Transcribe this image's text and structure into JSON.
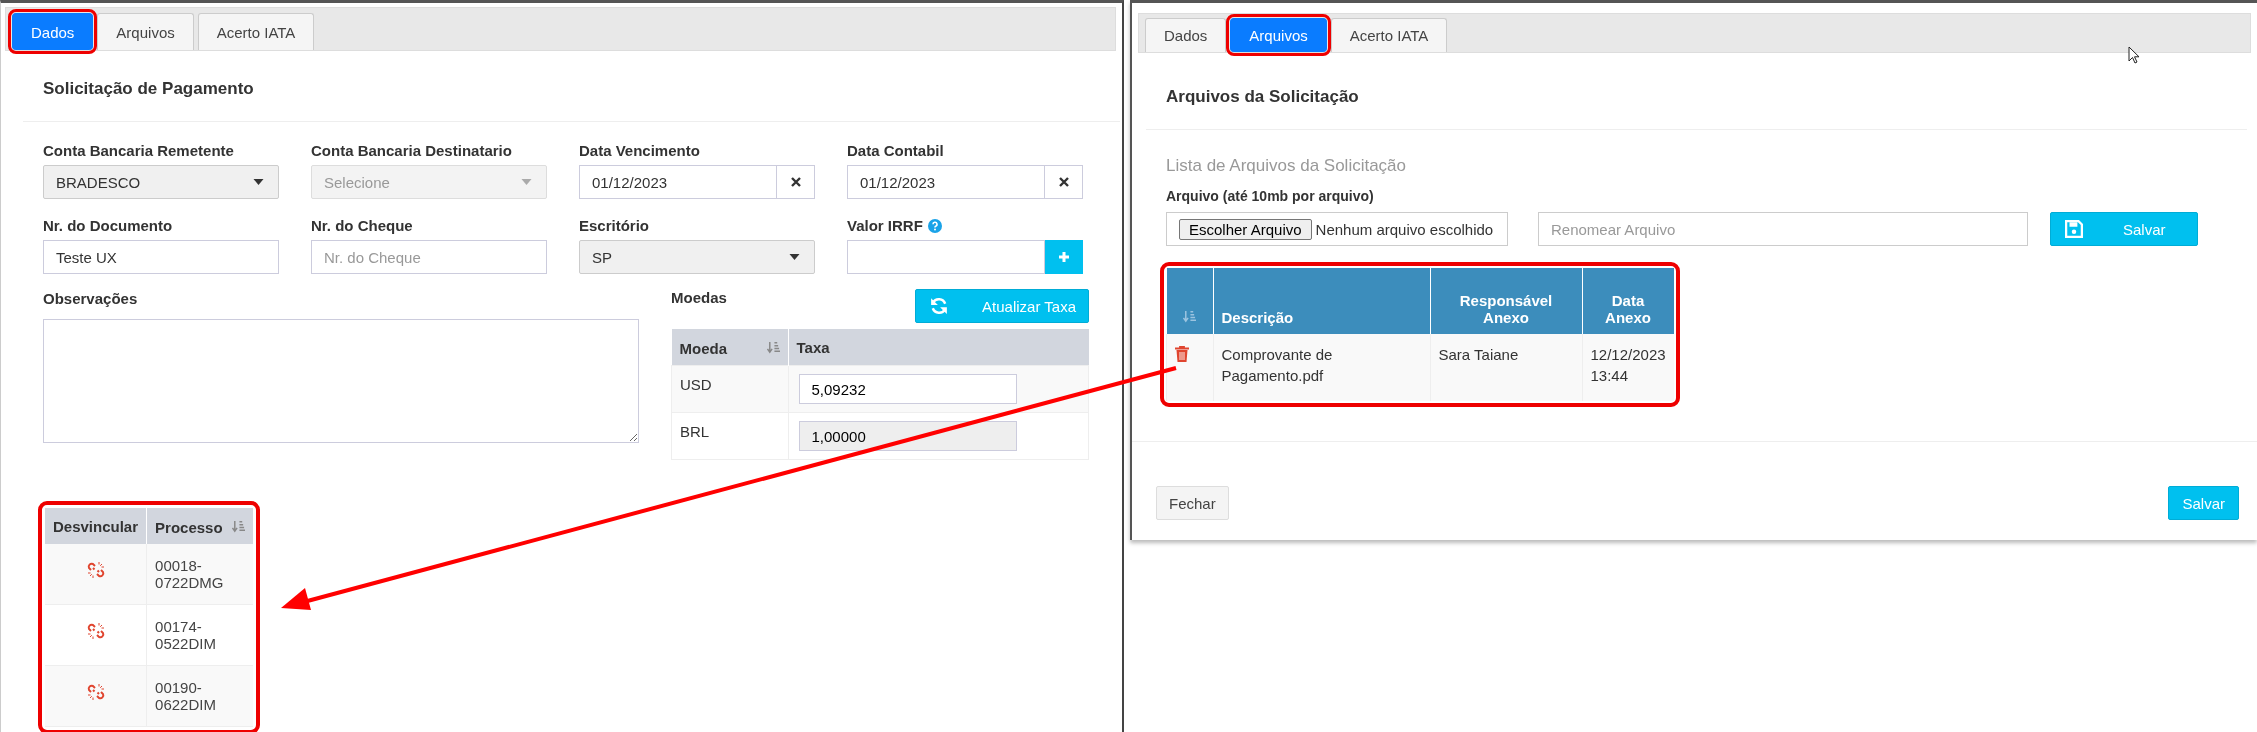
{
  "left_panel": {
    "tabs": [
      {
        "label": "Dados",
        "selected": true,
        "highlighted": true
      },
      {
        "label": "Arquivos",
        "selected": false,
        "highlighted": false
      },
      {
        "label": "Acerto IATA",
        "selected": false,
        "highlighted": false
      }
    ],
    "title": "Solicitação de Pagamento",
    "fields": [
      {
        "label": "Conta Bancaria Remetente",
        "kind": "select",
        "value": "BRADESCO",
        "disabled": false
      },
      {
        "label": "Conta Bancaria Destinatario",
        "kind": "select",
        "placeholder": "Selecione",
        "disabled": true
      },
      {
        "label": "Data Vencimento",
        "kind": "date",
        "value": "01/12/2023"
      },
      {
        "label": "Data Contabil",
        "kind": "date",
        "value": "01/12/2023"
      },
      {
        "label": "Nr. do Documento",
        "kind": "text",
        "value": "Teste UX"
      },
      {
        "label": "Nr. do Cheque",
        "kind": "text",
        "placeholder": "Nr. do Cheque"
      },
      {
        "label": "Escritório",
        "kind": "select",
        "value": "SP",
        "disabled": false
      },
      {
        "label": "Valor IRRF",
        "kind": "add",
        "help": true
      }
    ],
    "notes": {
      "label": "Observações"
    },
    "currencies": {
      "label": "Moedas",
      "button": "Atualizar Taxa",
      "columns": [
        "Moeda",
        "Taxa"
      ],
      "rows": [
        {
          "currency": "USD",
          "rate": "5,09232",
          "disabled": false
        },
        {
          "currency": "BRL",
          "rate": "1,00000",
          "disabled": true
        }
      ]
    },
    "processes": {
      "highlighted": true,
      "columns": [
        "Desvincular",
        "Processo"
      ],
      "rows": [
        {
          "process": "00018-0722DMG"
        },
        {
          "process": "00174-0522DIM"
        },
        {
          "process": "00190-0622DIM"
        }
      ]
    }
  },
  "right_panel": {
    "tabs": [
      {
        "label": "Dados",
        "selected": false,
        "highlighted": false
      },
      {
        "label": "Arquivos",
        "selected": true,
        "highlighted": true
      },
      {
        "label": "Acerto IATA",
        "selected": false,
        "highlighted": false
      }
    ],
    "title": "Arquivos da Solicitação",
    "subtitle": "Lista de Arquivos da Solicitação",
    "file_label": "Arquivo (até 10mb por arquivo)",
    "file_button": "Escolher Arquivo",
    "file_status": "Nenhum arquivo escolhido",
    "rename": {
      "placeholder": "Renomear Arquivo"
    },
    "save_button": "Salvar",
    "files": {
      "highlighted": true,
      "columns": [
        "Descrição",
        "Responsável Anexo",
        "Data Anexo"
      ],
      "rows": [
        {
          "description": "Comprovante de Pagamento.pdf",
          "owner": "Sara Taiane",
          "date": "12/12/2023 13:44"
        }
      ]
    },
    "footer": {
      "close": "Fechar",
      "save": "Salvar"
    }
  }
}
